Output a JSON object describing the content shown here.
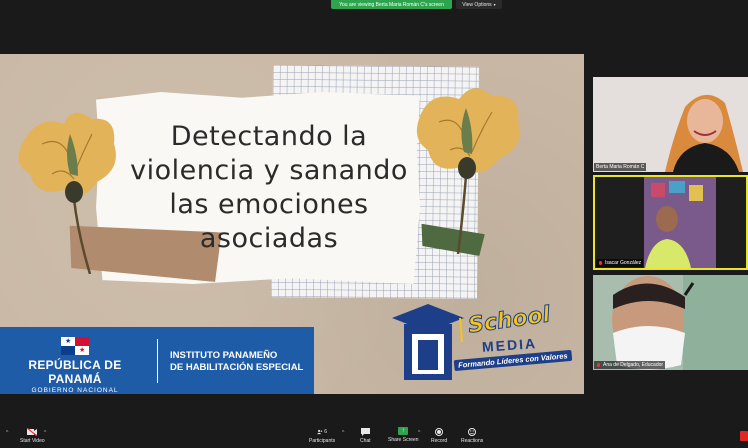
{
  "banner": {
    "viewing_text": "You are viewing Berta Maria Román C's screen",
    "view_options_label": "View Options",
    "colors": {
      "banner_bg": "#2ea44f"
    }
  },
  "slide": {
    "title_lines": [
      "Detectando la",
      "violencia y sanando",
      "las emociones",
      "asociadas"
    ],
    "gov_name": "REPÚBLICA DE PANAMÁ",
    "gov_sub": "GOBIERNO NACIONAL",
    "institute_line1": "INSTITUTO PANAMEÑO",
    "institute_line2": "DE HABILITACIÓN ESPECIAL",
    "logo_school": "School",
    "logo_media": "MEDIA",
    "logo_tagline": "Formando Líderes con Valores",
    "colors": {
      "background": "#c9b8a5",
      "gov_bar": "#1f5ca8",
      "logo_yellow": "#f5c518",
      "logo_blue": "#1d3f8a"
    }
  },
  "participants": [
    {
      "name": "Berta Maria Román C",
      "muted": false
    },
    {
      "name": "Isacar González",
      "muted": true
    },
    {
      "name": "Ana de Delgado, Educador",
      "muted": true
    }
  ],
  "toolbar": {
    "start_video": "Start Video",
    "participants": "Participants",
    "participants_count": "6",
    "chat": "Chat",
    "share_screen": "Share Screen",
    "record": "Record",
    "reactions": "Reactions"
  }
}
